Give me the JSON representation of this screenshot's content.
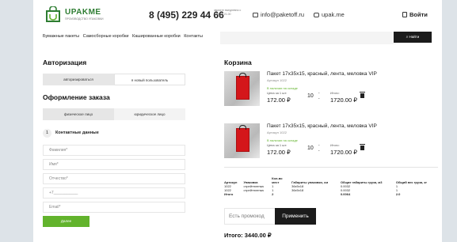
{
  "header": {
    "logo_name": "UPAKME",
    "logo_sub": "ПРОИЗВОДСТВО УПАКОВКИ",
    "phone": "8 (495) 229 44 66",
    "phone_note": "звоните ежедневно с 9.00 до 21.00",
    "email": "info@paketoff.ru",
    "instagram": "upak.me",
    "login": "Войти"
  },
  "nav": {
    "links": [
      "Бумажные пакеты",
      "Самосборные коробки",
      "Кашированные коробки",
      "Контакты"
    ],
    "search_placeholder": "",
    "search_button": "Найти"
  },
  "auth": {
    "title": "Авторизация",
    "options": [
      "авторизироваться",
      "я новый пользователь"
    ]
  },
  "order": {
    "title": "Оформление заказа",
    "options": [
      "физическое лицо",
      "юридическое лицо"
    ],
    "step_num": "1",
    "step_label": "Контактные данные",
    "fields": [
      "Фамилия*",
      "Имя*",
      "Отчество*",
      "+7___________",
      "",
      "Email*"
    ],
    "next_button": "Далее"
  },
  "cart": {
    "title": "Корзина",
    "items": [
      {
        "title": "Пакет 17х35х15, красный, лента, меловка VIP",
        "sku": "Артикул 1022",
        "stock": "В наличии на складе",
        "unit_label": "Цена за 1 шт:",
        "unit_price": "172.00 ₽",
        "qty": "10",
        "total_label": "Итого:",
        "total": "1720.00 ₽"
      },
      {
        "title": "Пакет 17х35х15, красный, лента, меловка VIP",
        "sku": "Артикул 1022",
        "stock": "В наличии на складе",
        "unit_label": "Цена за 1 шт:",
        "unit_price": "172.00 ₽",
        "qty": "10",
        "total_label": "Итого:",
        "total": "1720.00 ₽"
      }
    ],
    "table": {
      "headers": [
        "Артикул",
        "Упаковка",
        "Кол-во мест",
        "Габариты упаковки, см",
        "Общие габариты груза, м3",
        "Общий вес груза, кг"
      ],
      "rows": [
        [
          "1022",
          "стрейтпленка",
          "1",
          "36x5x18",
          "0.0032",
          "1"
        ],
        [
          "1022",
          "стрейтпленка",
          "1",
          "36x5x18",
          "0.0032",
          "1"
        ]
      ],
      "total_row": [
        "Итого",
        "",
        "2",
        "",
        "0.0064",
        "2.0"
      ]
    },
    "promo_placeholder": "Есть промокод",
    "apply_button": "Применить",
    "grand_total": "Итого: 3440.00 ₽"
  },
  "colors": {
    "accent": "#62b32c",
    "brand": "#2e7d32",
    "dark": "#1b1b1b",
    "product": "#d4161a"
  }
}
